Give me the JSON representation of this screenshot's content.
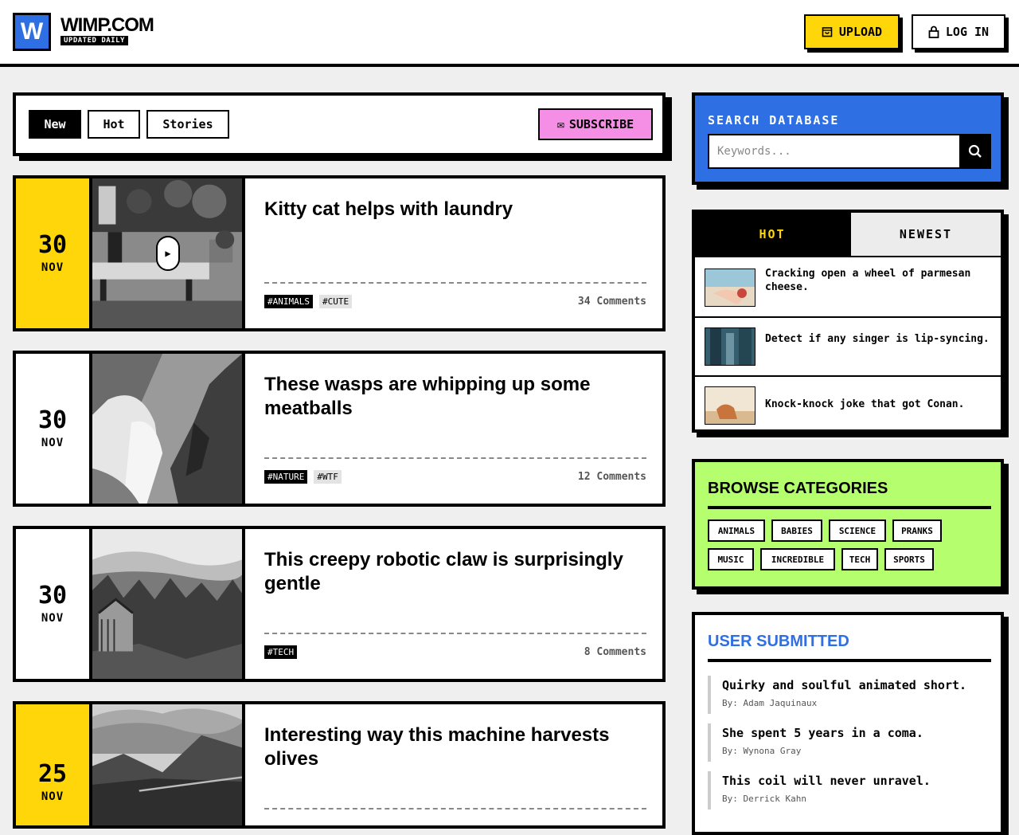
{
  "header": {
    "logo_letter": "W",
    "site_name": "WIMP.COM",
    "tagline": "UPDATED DAILY",
    "upload_label": "UPLOAD",
    "login_label": "LOG IN"
  },
  "filter": {
    "tabs": [
      "New",
      "Hot",
      "Stories"
    ],
    "active_tab": "New",
    "subscribe_icon": "✉",
    "subscribe_label": "SUBSCRIBE"
  },
  "posts": [
    {
      "day": "30",
      "month": "NOV",
      "title": "Kitty cat helps with laundry",
      "tags": [
        "#ANIMALS",
        "#CUTE"
      ],
      "comments": "34 Comments",
      "video": true
    },
    {
      "day": "30",
      "month": "NOV",
      "title": "These wasps are whipping up some meatballs",
      "tags": [
        "#NATURE",
        "#WTF"
      ],
      "comments": "12 Comments",
      "video": false
    },
    {
      "day": "30",
      "month": "NOV",
      "title": "This creepy robotic claw is surprisingly gentle",
      "tags": [
        "#TECH"
      ],
      "comments": "8 Comments",
      "video": false
    },
    {
      "day": "25",
      "month": "NOV",
      "title": "Interesting way this machine harvests olives",
      "tags": [],
      "comments": "",
      "video": false
    }
  ],
  "search": {
    "label": "SEARCH DATABASE",
    "placeholder": "Keywords..."
  },
  "hot_panel": {
    "tabs": [
      "HOT",
      "NEWEST"
    ],
    "items": [
      "Cracking open a wheel of parmesan cheese.",
      "Detect if any singer is lip-syncing.",
      "Knock-knock joke that got Conan."
    ]
  },
  "categories": {
    "title": "BROWSE CATEGORIES",
    "items": [
      "ANIMALS",
      "BABIES",
      "SCIENCE",
      "PRANKS",
      "MUSIC",
      "INCREDIBLE",
      "TECH",
      "SPORTS"
    ]
  },
  "user_submitted": {
    "title": "USER SUBMITTED",
    "items": [
      {
        "text": "Quirky and soulful animated short.",
        "by": "By: Adam Jaquinaux"
      },
      {
        "text": "She spent 5 years in a coma.",
        "by": "By: Wynona Gray"
      },
      {
        "text": "This coil will never unravel.",
        "by": "By: Derrick Kahn"
      }
    ]
  },
  "colors": {
    "brand_blue": "#2f6fe4",
    "yellow": "#ffd60a",
    "pink": "#f58fe6",
    "green": "#b5ff6e"
  }
}
